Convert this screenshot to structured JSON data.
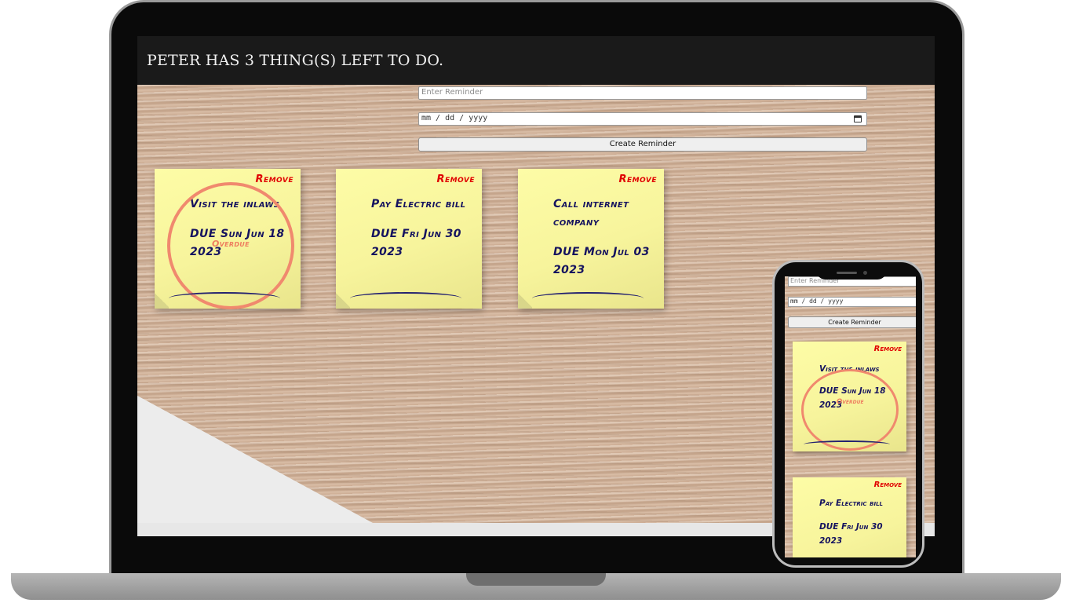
{
  "header": {
    "title": "PETER HAS 3 THING(S) LEFT TO DO."
  },
  "form": {
    "reminder_placeholder": "Enter Reminder",
    "date_placeholder": "mm / dd / yyyy",
    "create_label": "Create Reminder"
  },
  "notes": [
    {
      "remove_label": "Remove",
      "text": "Visit the inlaws",
      "due": "DUE Sun Jun 18 2023",
      "overdue_label": "Overdue"
    },
    {
      "remove_label": "Remove",
      "text": "Pay Electric bill",
      "due": "DUE Fri Jun 30 2023"
    },
    {
      "remove_label": "Remove",
      "text": "Call internet company",
      "due": "DUE Mon Jul 03 2023"
    }
  ],
  "icons": {
    "date_picker": "calendar-icon"
  },
  "colors": {
    "header_bg": "#1a1a1a",
    "note_bg": "#f9f6a0",
    "remove_text": "#e00000",
    "note_text": "#15135f",
    "overdue_accent": "#f0896e"
  }
}
